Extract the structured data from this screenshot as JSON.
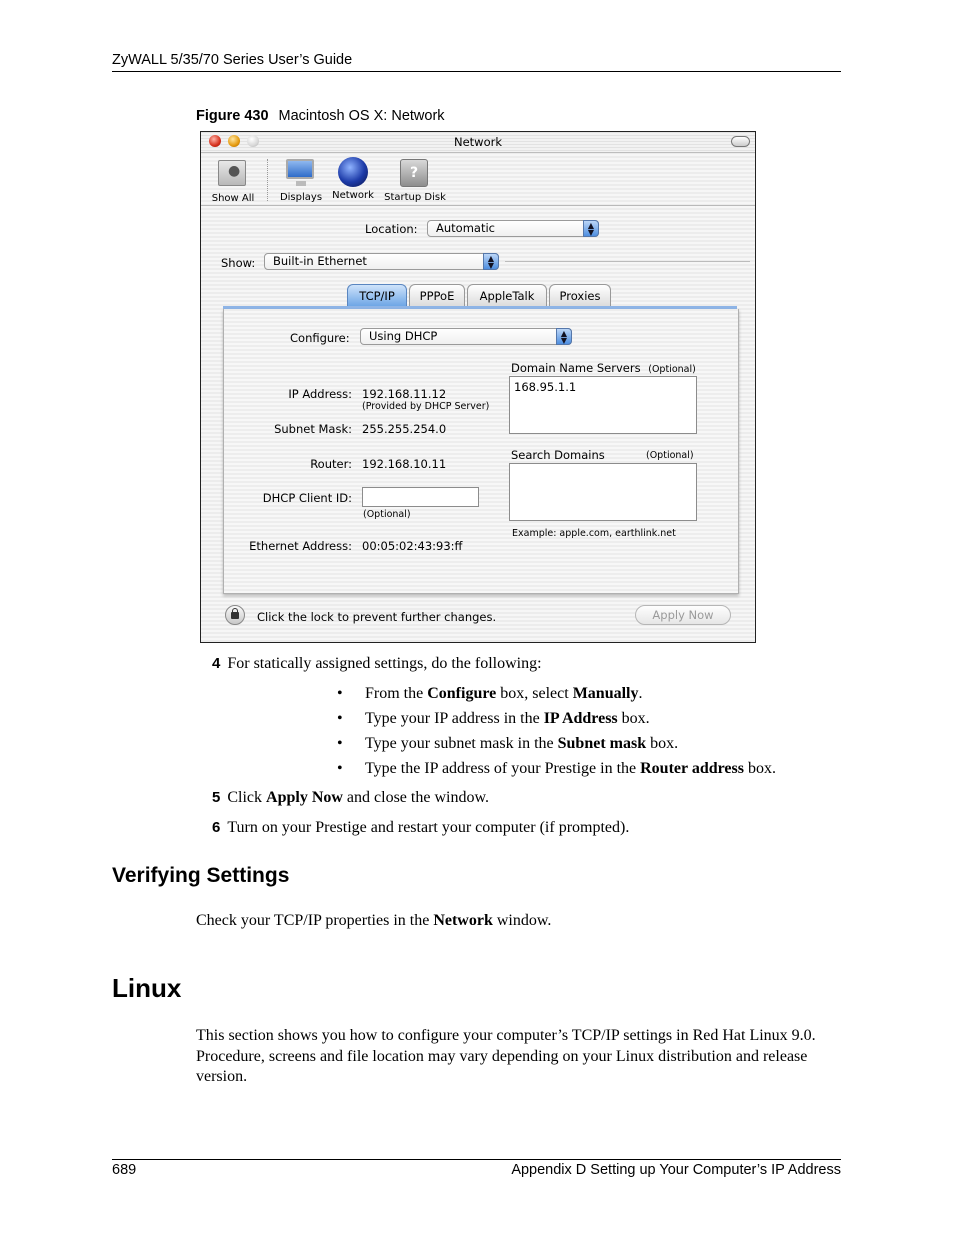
{
  "header": {
    "title": "ZyWALL 5/35/70 Series User’s Guide"
  },
  "figure": {
    "label": "Figure 430",
    "caption": "Macintosh OS X: Network"
  },
  "window": {
    "title": "Network",
    "toolbar": [
      {
        "label": "Show All",
        "icon": "apple-show-all-icon"
      },
      {
        "label": "Displays",
        "icon": "display-icon"
      },
      {
        "label": "Network",
        "icon": "globe-icon"
      },
      {
        "label": "Startup Disk",
        "icon": "disk-icon"
      }
    ],
    "location": {
      "label": "Location:",
      "value": "Automatic"
    },
    "show": {
      "label": "Show:",
      "value": "Built-in Ethernet"
    },
    "tabs": [
      {
        "label": "TCP/IP",
        "active": true
      },
      {
        "label": "PPPoE",
        "active": false
      },
      {
        "label": "AppleTalk",
        "active": false
      },
      {
        "label": "Proxies",
        "active": false
      }
    ],
    "tcpip": {
      "configure": {
        "label": "Configure:",
        "value": "Using DHCP"
      },
      "ip_address": {
        "label": "IP Address:",
        "value": "192.168.11.12",
        "note": "(Provided by DHCP Server)"
      },
      "subnet_mask": {
        "label": "Subnet Mask:",
        "value": "255.255.254.0"
      },
      "router": {
        "label": "Router:",
        "value": "192.168.10.11"
      },
      "dhcp_client_id": {
        "label": "DHCP Client ID:",
        "value": "",
        "note": "(Optional)"
      },
      "ethernet_address": {
        "label": "Ethernet Address:",
        "value": "00:05:02:43:93:ff"
      },
      "dns": {
        "label": "Domain Name Servers",
        "optional": "(Optional)",
        "value": "168.95.1.1"
      },
      "search_domains": {
        "label": "Search Domains",
        "optional": "(Optional)",
        "value": "",
        "example": "Example: apple.com, earthlink.net"
      }
    },
    "lock_text": "Click the lock to prevent further changes.",
    "apply_button": "Apply Now"
  },
  "steps": {
    "s4": {
      "num": "4",
      "text": "For statically assigned settings, do the following:"
    },
    "bullets": [
      {
        "pre": "From the ",
        "b1": "Configure",
        "mid": " box, select ",
        "b2": "Manually",
        "post": "."
      },
      {
        "pre": "Type your IP address in the ",
        "b1": "IP Address",
        "post": " box."
      },
      {
        "pre": "Type your subnet mask in the ",
        "b1": "Subnet mask",
        "post": " box."
      },
      {
        "pre": "Type the IP address of your Prestige in the ",
        "b1": "Router address",
        "post": " box."
      }
    ],
    "s5": {
      "num": "5",
      "pre": "Click ",
      "bold": "Apply Now",
      "post": " and close the window."
    },
    "s6": {
      "num": "6",
      "text": "Turn on your Prestige and restart your computer (if prompted)."
    }
  },
  "verify": {
    "heading": "Verifying Settings",
    "pre": "Check your TCP/IP properties in the ",
    "bold": "Network",
    "post": " window."
  },
  "linux": {
    "heading": "Linux",
    "paragraph": "This section shows you how to configure your computer’s TCP/IP settings in Red Hat Linux 9.0. Procedure, screens and file location may vary depending on your Linux distribution and release version."
  },
  "footer": {
    "page": "689",
    "title": "Appendix D Setting up Your Computer’s IP Address"
  }
}
